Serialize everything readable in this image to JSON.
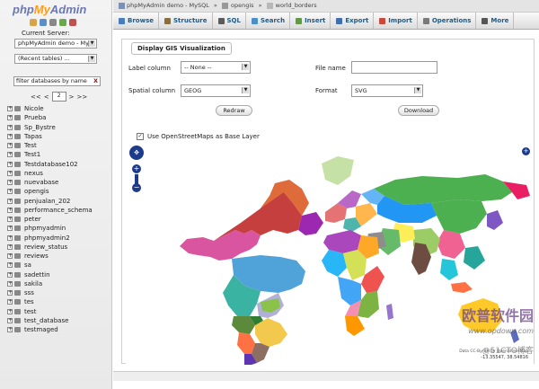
{
  "logo": {
    "php": "php",
    "my": "My",
    "admin": "Admin"
  },
  "sidebar": {
    "current_server_label": "Current Server:",
    "server_select": "phpMyAdmin demo - My",
    "recent_tables": "(Recent tables) ...",
    "filter_placeholder": "filter databases by name",
    "filter_clear": "X",
    "pager": {
      "first": "<<",
      "prev": "<",
      "page": "2",
      "next": ">",
      "last": ">>"
    },
    "databases": [
      "Nicole",
      "Prueba",
      "Sp_Bystre",
      "Tapas",
      "Test",
      "Test1",
      "Testdatabase102",
      "nexus",
      "nuevabase",
      "opengis",
      "penjualan_202",
      "performance_schema",
      "peter",
      "phpmyadmin",
      "phpmyadmin2",
      "review_status",
      "reviews",
      "sa",
      "sadettin",
      "sakila",
      "sss",
      "tes",
      "test",
      "test_database",
      "testmaged"
    ]
  },
  "breadcrumb": {
    "server": "phpMyAdmin demo - MySQL",
    "sep1": "»",
    "database": "opengis",
    "sep2": "»",
    "table": "world_borders"
  },
  "tabs": [
    {
      "label": "Browse",
      "color": "#4a7dbf"
    },
    {
      "label": "Structure",
      "color": "#8a6d3b"
    },
    {
      "label": "SQL",
      "color": "#5b5b5b"
    },
    {
      "label": "Search",
      "color": "#4a90c8"
    },
    {
      "label": "Insert",
      "color": "#5e9a3e"
    },
    {
      "label": "Export",
      "color": "#3f6fb0"
    },
    {
      "label": "Import",
      "color": "#c84a3a"
    },
    {
      "label": "Operations",
      "color": "#7a7a7a"
    },
    {
      "label": "More",
      "color": "#555555"
    }
  ],
  "gis": {
    "legend": "Display GIS Visualization",
    "label_column_label": "Label column",
    "label_column_value": "-- None --",
    "spatial_column_label": "Spatial column",
    "spatial_column_value": "GEOG",
    "file_name_label": "File name",
    "file_name_value": "",
    "format_label": "Format",
    "format_value": "SVG",
    "redraw": "Redraw",
    "download": "Download",
    "osm_label": "Use OpenStreetMaps as Base Layer",
    "osm_checked": "✓"
  },
  "map": {
    "coords": "-13.35547, 38.54816",
    "attribution": "Data CC-By-SA by OpenStreetMap"
  },
  "watermark": {
    "title": "欧普软件园",
    "url": "www.opdown.com",
    "site": "@51CTO博客"
  }
}
